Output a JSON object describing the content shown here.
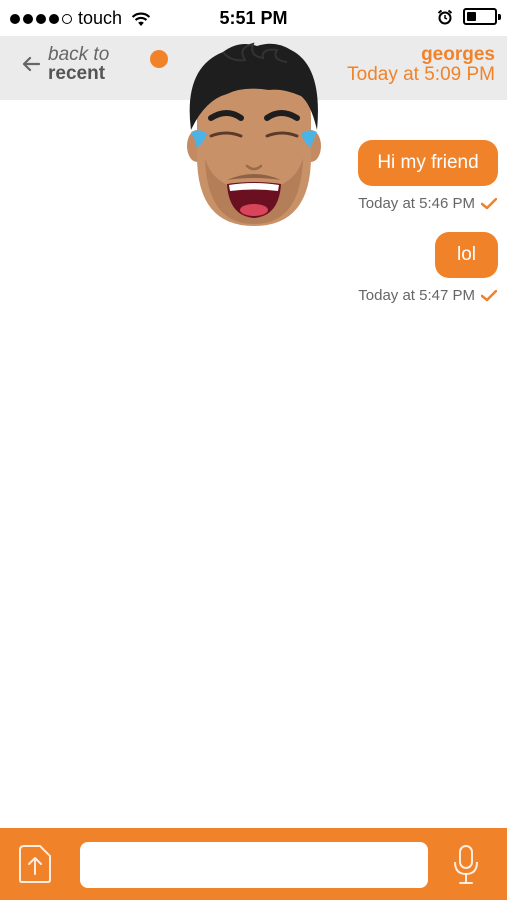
{
  "status_bar": {
    "carrier": "touch",
    "time": "5:51 PM",
    "signal_bars": 4,
    "signal_total": 5,
    "battery_level": 0.35
  },
  "header": {
    "back_line1": "back to",
    "back_line2": "recent",
    "contact_name": "georges",
    "contact_time": "Today at 5:09 PM",
    "online_status_color": "#f0832a"
  },
  "messages": [
    {
      "text": "Hi my friend",
      "timestamp": "Today at 5:46 PM",
      "status_icon": "checkmark-icon"
    },
    {
      "text": "lol",
      "timestamp": "Today at 5:47 PM",
      "status_icon": "checkmark-icon"
    }
  ],
  "composer": {
    "input_value": "",
    "placeholder": ""
  },
  "colors": {
    "accent": "#f0832a",
    "header_bg": "#ebebeb"
  }
}
